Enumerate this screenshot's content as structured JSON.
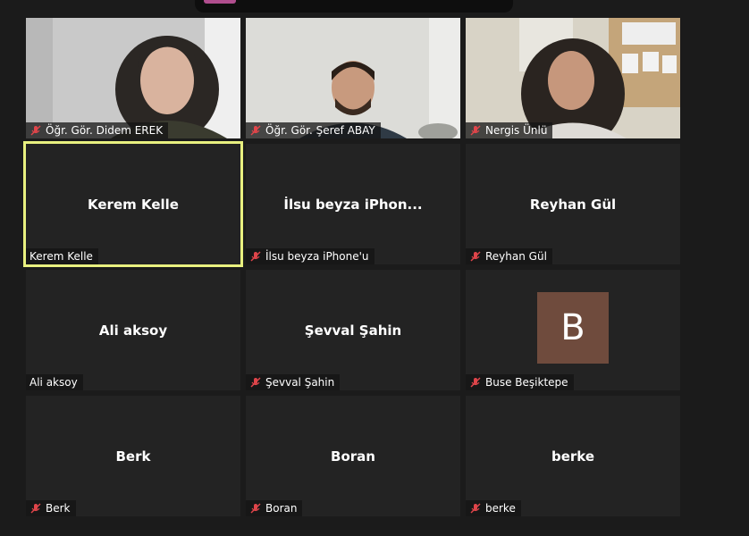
{
  "participants": [
    {
      "name": "Öğr. Gör. Didem EREK",
      "label": "Öğr. Gör. Didem EREK",
      "video": true,
      "muted": true
    },
    {
      "name": "Öğr. Gör. Şeref ABAY",
      "label": "Öğr. Gör. Şeref ABAY",
      "video": true,
      "muted": true
    },
    {
      "name": "Nergis Ünlü",
      "label": "Nergis Ünlü",
      "video": true,
      "muted": true
    },
    {
      "name": "Kerem Kelle",
      "display": "Kerem Kelle",
      "label": "Kerem Kelle",
      "video": false,
      "muted": false,
      "active_speaker": true
    },
    {
      "name": "İlsu beyza iPhone'u",
      "display": "İlsu beyza iPhon...",
      "label": "İlsu beyza iPhone'u",
      "video": false,
      "muted": true
    },
    {
      "name": "Reyhan Gül",
      "display": "Reyhan Gül",
      "label": "Reyhan Gül",
      "video": false,
      "muted": true
    },
    {
      "name": "Ali aksoy",
      "display": "Ali aksoy",
      "label": "Ali aksoy",
      "video": false,
      "muted": false
    },
    {
      "name": "Şevval Şahin",
      "display": "Şevval Şahin",
      "label": "Şevval Şahin",
      "video": false,
      "muted": true
    },
    {
      "name": "Buse Beşiktepe",
      "avatar_letter": "B",
      "label": "Buse Beşiktepe",
      "video": false,
      "muted": true
    },
    {
      "name": "Berk",
      "display": "Berk",
      "label": "Berk",
      "video": false,
      "muted": true
    },
    {
      "name": "Boran",
      "display": "Boran",
      "label": "Boran",
      "video": false,
      "muted": true
    },
    {
      "name": "berke",
      "display": "berke",
      "label": "berke",
      "video": false,
      "muted": true
    }
  ],
  "colors": {
    "background": "#1b1b1b",
    "tile": "#232323",
    "active_outline": "#e8f07f",
    "muted_mic": "#e0454a",
    "avatar": "#6f4b3d"
  },
  "icons": {
    "muted": "mic-muted-icon"
  }
}
